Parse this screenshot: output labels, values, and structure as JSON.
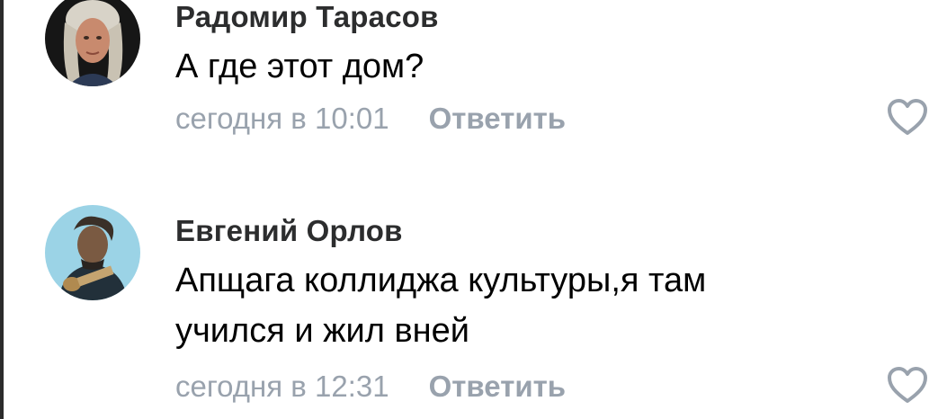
{
  "comments": [
    {
      "author": "Радомир Тарасов",
      "text_lines": [
        "А где этот дом?"
      ],
      "time": "сегодня в 10:01",
      "reply_label": "Ответить",
      "like_icon": "heart-outline-icon"
    },
    {
      "author": "Евгений Орлов",
      "text_lines": [
        "Апщага коллиджа культуры,я там",
        "учился и жил вней"
      ],
      "time": "сегодня в 12:31",
      "reply_label": "Ответить",
      "like_icon": "heart-outline-icon"
    }
  ],
  "colors": {
    "author": "#2c2d2e",
    "text": "#000000",
    "meta": "#99a2ad",
    "like_outline": "#99a2ad"
  }
}
